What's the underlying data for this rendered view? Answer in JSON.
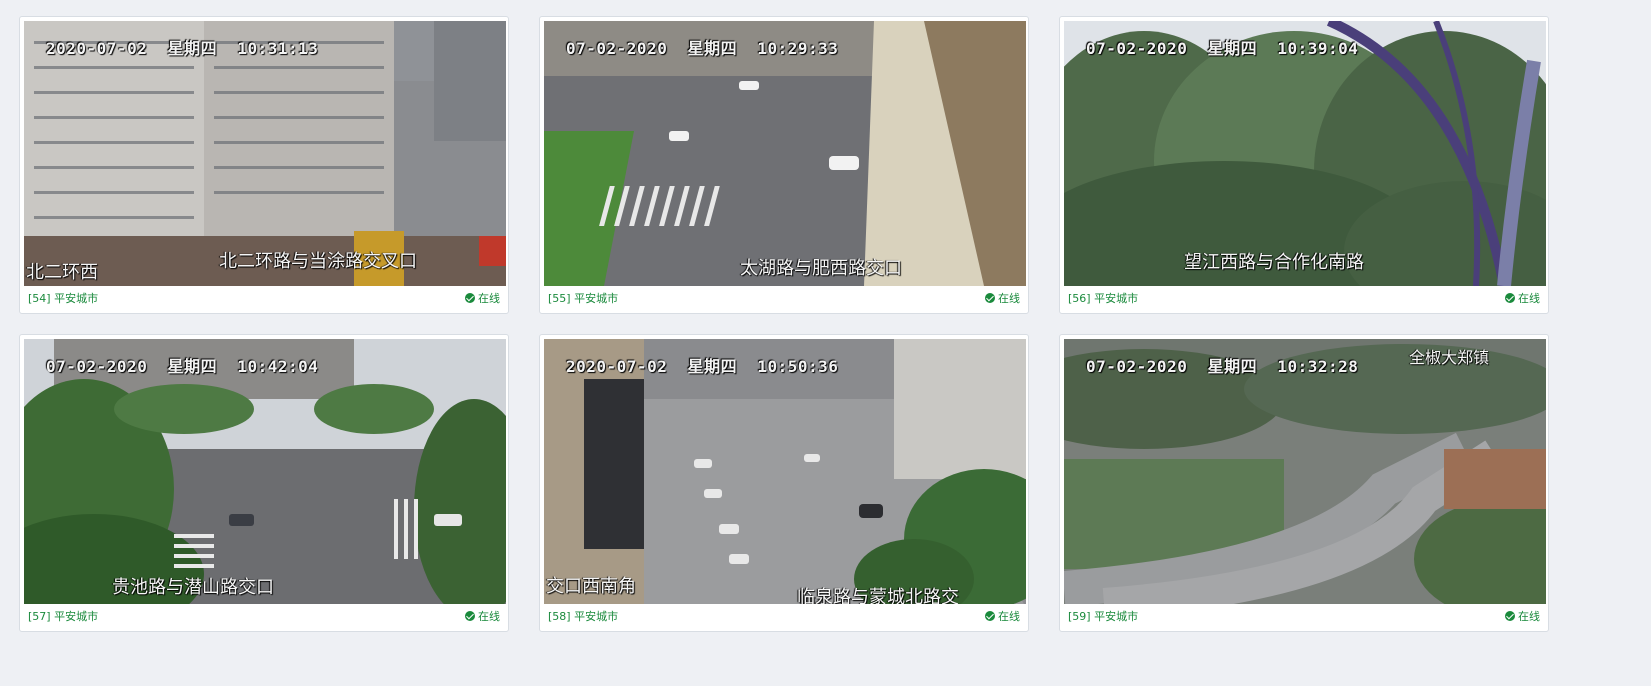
{
  "cameras": [
    {
      "id_label": "[54]",
      "group_label": "平安城市",
      "status": "在线",
      "timestamp": "2020-07-02  星期四  10:31:13",
      "location": "北二环路与当涂路交叉口",
      "location_2": "北二环西"
    },
    {
      "id_label": "[55]",
      "group_label": "平安城市",
      "status": "在线",
      "timestamp": "07-02-2020  星期四  10:29:33",
      "location": "太湖路与肥西路交口"
    },
    {
      "id_label": "[56]",
      "group_label": "平安城市",
      "status": "在线",
      "timestamp": "07-02-2020  星期四  10:39:04",
      "location": "望江西路与合作化南路"
    },
    {
      "id_label": "[57]",
      "group_label": "平安城市",
      "status": "在线",
      "timestamp": "07-02-2020  星期四  10:42:04",
      "location": "贵池路与潜山路交口"
    },
    {
      "id_label": "[58]",
      "group_label": "平安城市",
      "status": "在线",
      "timestamp": "2020-07-02  星期四  10:50:36",
      "location": "临泉路与蒙城北路交",
      "location_2": "交口西南角"
    },
    {
      "id_label": "[59]",
      "group_label": "平安城市",
      "status": "在线",
      "timestamp": "07-02-2020  星期四  10:32:28",
      "location": "全椒大郑镇"
    }
  ],
  "colors": {
    "status_green": "#1a8a3c",
    "page_bg": "#eef0f4"
  }
}
